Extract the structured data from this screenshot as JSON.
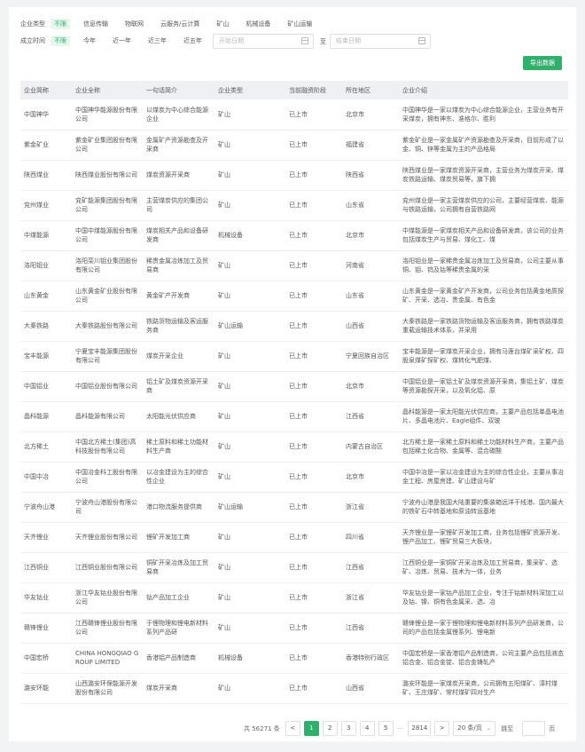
{
  "filters": {
    "type_label": "企业类型",
    "type_options": [
      "不限",
      "信息传输",
      "物联网",
      "云服务/云计算",
      "矿山",
      "机械设备",
      "矿山运输"
    ],
    "time_label": "成立时间",
    "time_options": [
      "不限",
      "今年",
      "近一年",
      "近三年",
      "近五年"
    ],
    "start_placeholder": "开始日期",
    "separator": "至",
    "end_placeholder": "结束日期"
  },
  "export_label": "导出数据",
  "table": {
    "headers": [
      "企业简称",
      "企业全称",
      "一句话简介",
      "企业类型",
      "当前融资阶段",
      "所在地区",
      "企业介绍"
    ],
    "rows": [
      [
        "中国神华",
        "中国神华能源股份有限公司",
        "以煤炭为中心综合能源企业",
        "矿山",
        "已上市",
        "北京市",
        "中国神华是一家以煤炭为中心综合能源企业，主营业务有开采煤炭，拥有神东、准格尔、胜利"
      ],
      [
        "紫金矿业",
        "紫金矿业集团股份有限公司",
        "金属矿产资源勘查及开采商",
        "矿山",
        "已上市",
        "福建省",
        "紫金矿业是一家金属矿产资源勘查及开采商，目前形成了以金、铜、锌等金属为主的产品格局"
      ],
      [
        "陕西煤业",
        "陕西煤业股份有限公司",
        "煤炭资源开采商",
        "矿山",
        "已上市",
        "陕西省",
        "陕西煤业是一家煤炭资源开采商，主营业务为煤炭开采、煤炭铁路运输、煤炭贸易等，旗下拥"
      ],
      [
        "兖州煤业",
        "兖矿能源集团股份有限公司",
        "主营煤炭供应的集团公司",
        "矿山",
        "已上市",
        "山东省",
        "兖州煤业是一家主营煤炭供应的公司，主要经营煤炭、能源与铁路运输，公司拥有自营铁路网"
      ],
      [
        "中煤能源",
        "中国中煤能源股份有限公司",
        "煤炭相关产品和设备研发商",
        "机械设备",
        "已上市",
        "北京市",
        "中煤能源是一家煤炭相关产品和设备研发商，该公司的业务包括煤炭生产与贸易、煤化工、煤"
      ],
      [
        "洛阳钼业",
        "洛阳栾川钼业集团股份有限公司",
        "稀贵金属冶炼加工及贸易商",
        "矿山",
        "已上市",
        "河南省",
        "洛阳钼业是一家稀贵金属冶炼加工及贸易商，公司主要从事铜、钼、钨及钴等稀贵金属的采"
      ],
      [
        "山东黄金",
        "山东黄金矿业股份有限公司",
        "黄金矿产开发商",
        "矿山",
        "已上市",
        "山东省",
        "山东黄金是一家黄金矿产开发商，公司业务包括黄金地质探矿、开采、选冶、贵金属、有色金"
      ],
      [
        "大秦铁路",
        "大秦铁路股份有限公司",
        "铁路货物运输及客运服务商",
        "矿山运输",
        "已上市",
        "山西省",
        "大秦铁路是一家铁路货物运输及客运服务商，拥有铁路煤炭重载运输技术体系，并采用"
      ],
      [
        "宝丰能源",
        "宁夏宝丰能源集团股份有限公司",
        "煤炭开采企业",
        "矿山",
        "已上市",
        "宁夏回族自治区",
        "宝丰能源是一家煤炭开采企业，拥有马莲台煤矿采矿权、四股泉煤矿探矿权、煤转化气肥煤、"
      ],
      [
        "中国铝业",
        "中国铝业股份有限公司",
        "铝土矿及煤炭资源开采商",
        "矿山",
        "已上市",
        "北京市",
        "中国铝业是一家铝土矿及煤炭资源开采商，集铝土矿、煤炭等资源勘探开采，以及氧化铝、原"
      ],
      [
        "晶科能源",
        "晶科能源有限公司",
        "太阳能光伏供应商",
        "矿山",
        "已上市",
        "江西省",
        "晶科能源是一家太阳能光伏供应商，主要产品包括单晶电池片、多晶电池片、Eagle组件、双玻"
      ],
      [
        "北方稀土",
        "中国北方稀土(集团)高科技股份有限公司",
        "稀土原料和稀土功能材料生产商",
        "矿山",
        "已上市",
        "内蒙古自治区",
        "北方稀土是一家稀土原料和稀土功能材料生产商，主要产品包括稀土化合物、金属等、混合碳酸"
      ],
      [
        "中国中冶",
        "中国冶金科工股份有限公司",
        "以冶金建设为主的综合性企业",
        "矿山",
        "已上市",
        "北京市",
        "中国中冶是一家以冶金建设为主的综合性企业，主要从事冶金工程、房屋房建、矿山建设与矿"
      ],
      [
        "宁波舟山港",
        "宁波舟山港股份有限公司",
        "港口物流服务提供商",
        "矿山运输",
        "已上市",
        "浙江省",
        "宁波舟山港是我国大陆重要的集装箱远洋干线港、国内最大的铁矿石中转基地和原油转运基地"
      ],
      [
        "天齐锂业",
        "天齐锂业股份有限公司",
        "锂矿开发加工商",
        "矿山",
        "已上市",
        "四川省",
        "天齐锂业是一家锂矿开发加工商，业务包括锂矿资源开发、锂产品加工、锂矿贸易三大板块，"
      ],
      [
        "江西铜业",
        "江西铜业股份有限公司",
        "铜矿开采冶炼及加工贸易商",
        "矿山",
        "已上市",
        "江西省",
        "江西铜业是一家铜矿开采冶炼及加工贸易商，集采矿、选矿、冶炼、贸易、技术为一体，业务"
      ],
      [
        "华友钴业",
        "浙江华友钴业股份有限公司",
        "钴产品加工企业",
        "矿山",
        "已上市",
        "浙江省",
        "华友钴业是一家钴产品加工企业，专注于钴新材料深加工以及钴、镍、铜有色金属采、选、冶"
      ],
      [
        "赣锋锂业",
        "江西赣锋锂业股份有限公司",
        "于锂物理和锂电新材料系列产品研",
        "矿山",
        "已上市",
        "江西省",
        "赣锋锂业是一家于锂物理和锂电新材料系列产品研发商，公司的产品包括金属锂系列、锂电新"
      ],
      [
        "中国宏桥",
        "CHINA HONGQIAO GROUP LIMITED",
        "香港铝产品制造商",
        "机械设备",
        "已上市",
        "香港特别行政区",
        "中国宏桥是一家香港铝产品制造商，公司主要产品包括液态铝合金、铝合金锭、铝合金铸轧产"
      ],
      [
        "潞安环能",
        "山西潞安环保能源开发股份有限公司",
        "煤炭开采商",
        "矿山",
        "已上市",
        "山西省",
        "潞安环能是一家煤炭开采商，公司拥有五阳煤矿、漳村煤矿、王庄煤矿、常村煤矿四对生产"
      ]
    ]
  },
  "pagination": {
    "total": "共 56271 条",
    "prev": "<",
    "pages": [
      "1",
      "2",
      "3",
      "4",
      "5"
    ],
    "dots": "···",
    "last": "2814",
    "next": ">",
    "size": "20 条/页",
    "jump_label": "跳至",
    "jump_suffix": "页"
  }
}
